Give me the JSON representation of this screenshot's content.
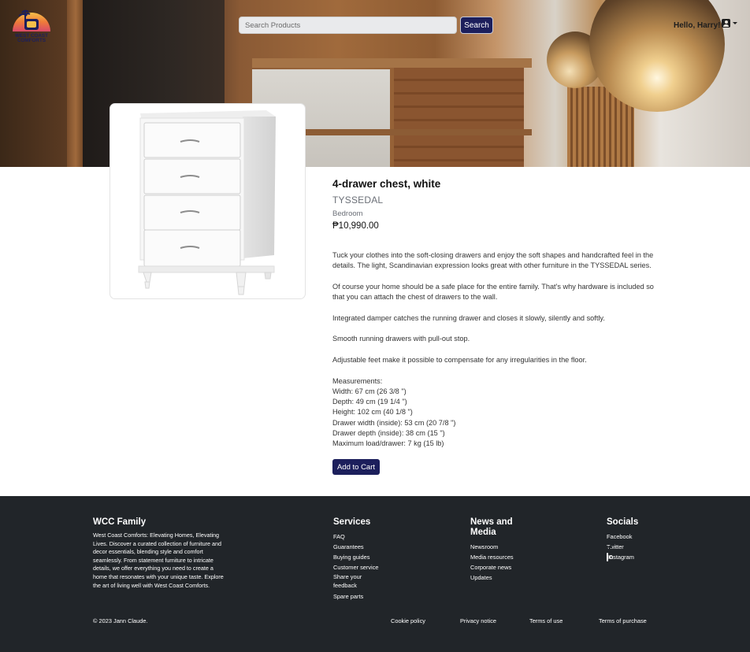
{
  "header": {
    "logo_text_line1": "WEST COAST",
    "logo_text_line2": "COMFORTS",
    "search_placeholder": "Search Products",
    "search_button": "Search",
    "greeting": "Hello, Harry!",
    "user_icon": "user-icon"
  },
  "product": {
    "name": "4-drawer chest, white",
    "series": "TYSSEDAL",
    "category": "Bedroom",
    "price": "₱10,990.00",
    "description": [
      "Tuck your clothes into the soft-closing drawers and enjoy the soft shapes and handcrafted feel in the details. The light, Scandinavian expression looks great with other furniture in the TYSSEDAL series.",
      "Of course your home should be a safe place for the entire family. That's why hardware is included so that you can attach the chest of drawers to the wall.",
      "Integrated damper catches the running drawer and closes it slowly, silently and softly.",
      "Smooth running drawers with pull-out stop.",
      "Adjustable feet make it possible to compensate for any irregularities in the floor."
    ],
    "measurements_title": "Measurements:",
    "measurements": [
      "Width: 67 cm (26 3/8 \")",
      "Depth: 49 cm (19 1/4 \")",
      "Height: 102 cm (40 1/8 \")",
      "Drawer width (inside): 53 cm (20 7/8 \")",
      "Drawer depth (inside): 38 cm (15 \")",
      "Maximum load/drawer: 7 kg (15 lb)"
    ],
    "add_to_cart": "Add to Cart"
  },
  "footer": {
    "about_title": "WCC Family",
    "about_text": "West Coast Comforts: Elevating Homes, Elevating Lives. Discover a curated collection of furniture and decor essentials, blending style and comfort seamlessly. From statement furniture to intricate details, we offer everything you need to create a home that resonates with your unique taste. Explore the art of living well with West Coast Comforts.",
    "services_title": "Services",
    "services": [
      "FAQ",
      "Guarantees",
      "Buying guides",
      "Customer service",
      "Share your feedback",
      "Spare parts"
    ],
    "news_title": "News and Media",
    "news": [
      "Newsroom",
      "Media resources",
      "Corporate news",
      "Updates"
    ],
    "socials_title": "Socials",
    "socials": [
      {
        "label": "Facebook",
        "icon": "facebook-icon"
      },
      {
        "label": "Twitter",
        "icon": "twitter-icon"
      },
      {
        "label": "Instagram",
        "icon": "instagram-icon"
      }
    ],
    "copyright": "© 2023 Jann Claude.",
    "bottom_links": [
      "Cookie policy",
      "Privacy notice",
      "Terms of use",
      "Terms of purchase"
    ]
  },
  "colors": {
    "primary_button": "#1c1f5c",
    "footer_bg": "#212529",
    "muted_text": "#6b6f77"
  }
}
